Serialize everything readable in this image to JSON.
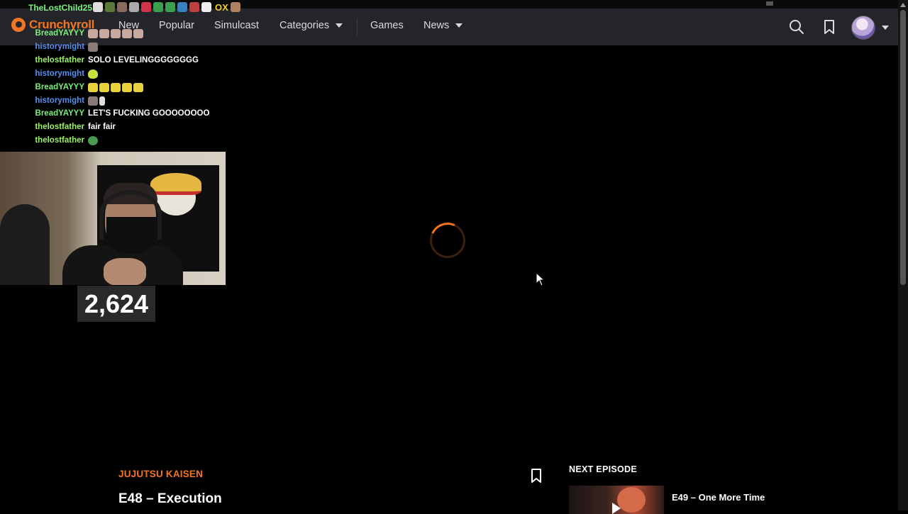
{
  "nav": {
    "logo": "Crunchyroll",
    "items": [
      {
        "label": "New",
        "dropdown": false
      },
      {
        "label": "Popular",
        "dropdown": false
      },
      {
        "label": "Simulcast",
        "dropdown": false
      },
      {
        "label": "Categories",
        "dropdown": true
      },
      {
        "label": "Games",
        "dropdown": false
      },
      {
        "label": "News",
        "dropdown": true
      }
    ],
    "icons": [
      "search-icon",
      "bookmark-icon",
      "avatar",
      "chevron-down-icon"
    ]
  },
  "chat": {
    "top_user": "TheLostChild25",
    "top_suffix": "OX",
    "messages": [
      {
        "user": "BreadYAYYY",
        "text": "",
        "color": "#7cf07c"
      },
      {
        "user": "historymight",
        "text": "",
        "color": "#5a8ff0"
      },
      {
        "user": "thelostfather",
        "text": "SOLO LEVELINGGGGGGGG",
        "color": "#9ff06b"
      },
      {
        "user": "historymight",
        "text": "",
        "color": "#5a8ff0"
      },
      {
        "user": "BreadYAYYY",
        "text": "",
        "color": "#7cf07c"
      },
      {
        "user": "historymight",
        "text": "",
        "color": "#5a8ff0"
      },
      {
        "user": "BreadYAYYY",
        "text": "LET'S FUCKING GOOOOOOOO",
        "color": "#7cf07c"
      },
      {
        "user": "thelostfather",
        "text": "fair fair",
        "color": "#9ff06b"
      },
      {
        "user": "thelostfather",
        "text": "",
        "color": "#9ff06b"
      }
    ]
  },
  "webcam": {
    "viewer_count": "2,624"
  },
  "player": {
    "state": "loading",
    "accent": "#f47521"
  },
  "episode": {
    "series": "JUJUTSU KAISEN",
    "title": "E48 – Execution"
  },
  "next_episode": {
    "label": "NEXT EPISODE",
    "title": "E49 – One More Time"
  }
}
